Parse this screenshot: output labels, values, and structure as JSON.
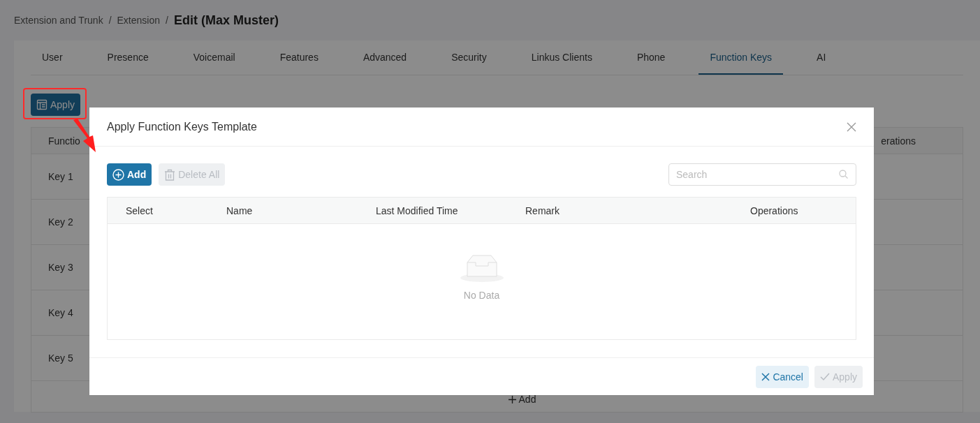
{
  "breadcrumb": [
    {
      "label": "Extension and Trunk",
      "separator": "/"
    },
    {
      "label": "Extension",
      "separator": "/"
    }
  ],
  "page_title": "Edit (Max Muster)",
  "tabs": [
    {
      "label": "User",
      "selected": false
    },
    {
      "label": "Presence",
      "selected": false
    },
    {
      "label": "Voicemail",
      "selected": false
    },
    {
      "label": "Features",
      "selected": false
    },
    {
      "label": "Advanced",
      "selected": false
    },
    {
      "label": "Security",
      "selected": false
    },
    {
      "label": "Linkus Clients",
      "selected": false
    },
    {
      "label": "Phone",
      "selected": false
    },
    {
      "label": "Function Keys",
      "selected": true
    },
    {
      "label": "AI",
      "selected": false
    }
  ],
  "apply_template_button": "Apply",
  "keys_table": {
    "column_1": "Functio",
    "column_last": "erations",
    "rows": [
      "Key 1",
      "Key 2",
      "Key 3",
      "Key 4",
      "Key 5"
    ],
    "add_button": "Add"
  },
  "dialog": {
    "title": "Apply Function Keys Template",
    "add_button": {
      "label": "Add",
      "disabled": false
    },
    "delete_all_button": {
      "label": "Delete All",
      "disabled": true
    },
    "search": {
      "placeholder": "Search"
    },
    "columns": [
      "Select",
      "Name",
      "Last Modified Time",
      "Remark",
      "Operations"
    ],
    "empty_text": "No Data",
    "cancel_button": {
      "label": "Cancel",
      "disabled": false
    },
    "apply_button": {
      "label": "Apply",
      "disabled": true
    }
  }
}
